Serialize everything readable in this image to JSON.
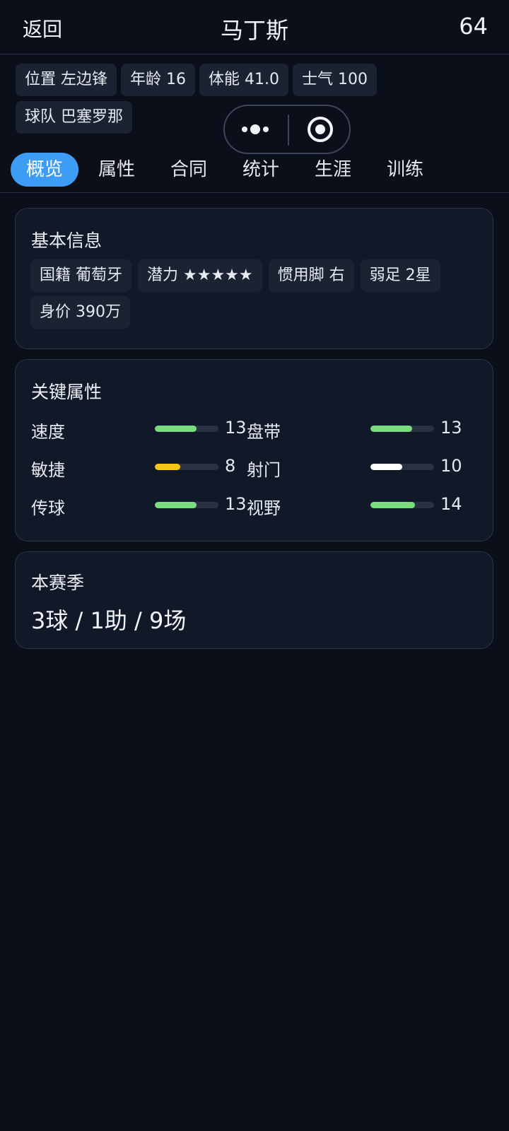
{
  "header": {
    "back_label": "返回",
    "title": "马丁斯",
    "rating": "64"
  },
  "player_chips": [
    "位置 左边锋",
    "年龄 16",
    "体能 41.0",
    "士气 100",
    "球队 巴塞罗那"
  ],
  "capsule": {
    "menu_icon": "more-dots-icon",
    "close_icon": "record-target-icon"
  },
  "tabs": [
    "概览",
    "属性",
    "合同",
    "统计",
    "生涯",
    "训练"
  ],
  "active_tab": "概览",
  "basic_info": {
    "title": "基本信息",
    "chips": [
      "国籍 葡萄牙",
      "潜力 ★★★★★",
      "惯用脚 右",
      "弱足 2星",
      "身价 390万"
    ]
  },
  "key_attributes": {
    "title": "关键属性",
    "items": [
      {
        "label": "速度",
        "value": "13",
        "fill": 0.65,
        "color": "#7bdc7e"
      },
      {
        "label": "盘带",
        "value": "13",
        "fill": 0.65,
        "color": "#7bdc7e"
      },
      {
        "label": "敏捷",
        "value": "8",
        "fill": 0.4,
        "color": "#f5c518"
      },
      {
        "label": "射门",
        "value": "10",
        "fill": 0.5,
        "color": "#ffffff"
      },
      {
        "label": "传球",
        "value": "13",
        "fill": 0.65,
        "color": "#7bdc7e"
      },
      {
        "label": "视野",
        "value": "14",
        "fill": 0.7,
        "color": "#7bdc7e"
      }
    ]
  },
  "season": {
    "title": "本赛季",
    "summary": "3球 / 1助 / 9场"
  }
}
